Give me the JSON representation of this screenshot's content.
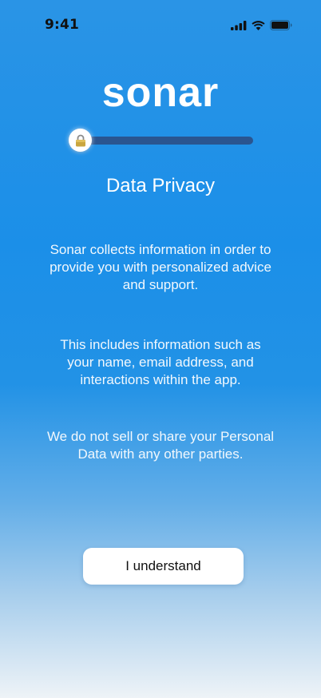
{
  "status_bar": {
    "time": "9:41",
    "icons": [
      "cellular-signal-icon",
      "wifi-icon",
      "battery-icon"
    ]
  },
  "brand": {
    "logo_text": "sonar"
  },
  "progress": {
    "value": 0,
    "icon": "lock-icon"
  },
  "screen": {
    "title": "Data Privacy",
    "paragraphs": [
      "Sonar collects information in order to provide you with personalized advice and support.",
      "This includes information such as your name, email address, and interactions within the app.",
      "We do not sell or share your Personal Data with any other parties."
    ]
  },
  "actions": {
    "primary_label": "I understand"
  },
  "colors": {
    "background_top": "#2a94e6",
    "background_bottom": "#eef3f7",
    "progress_track": "#2a5590",
    "button_bg": "#ffffff"
  }
}
